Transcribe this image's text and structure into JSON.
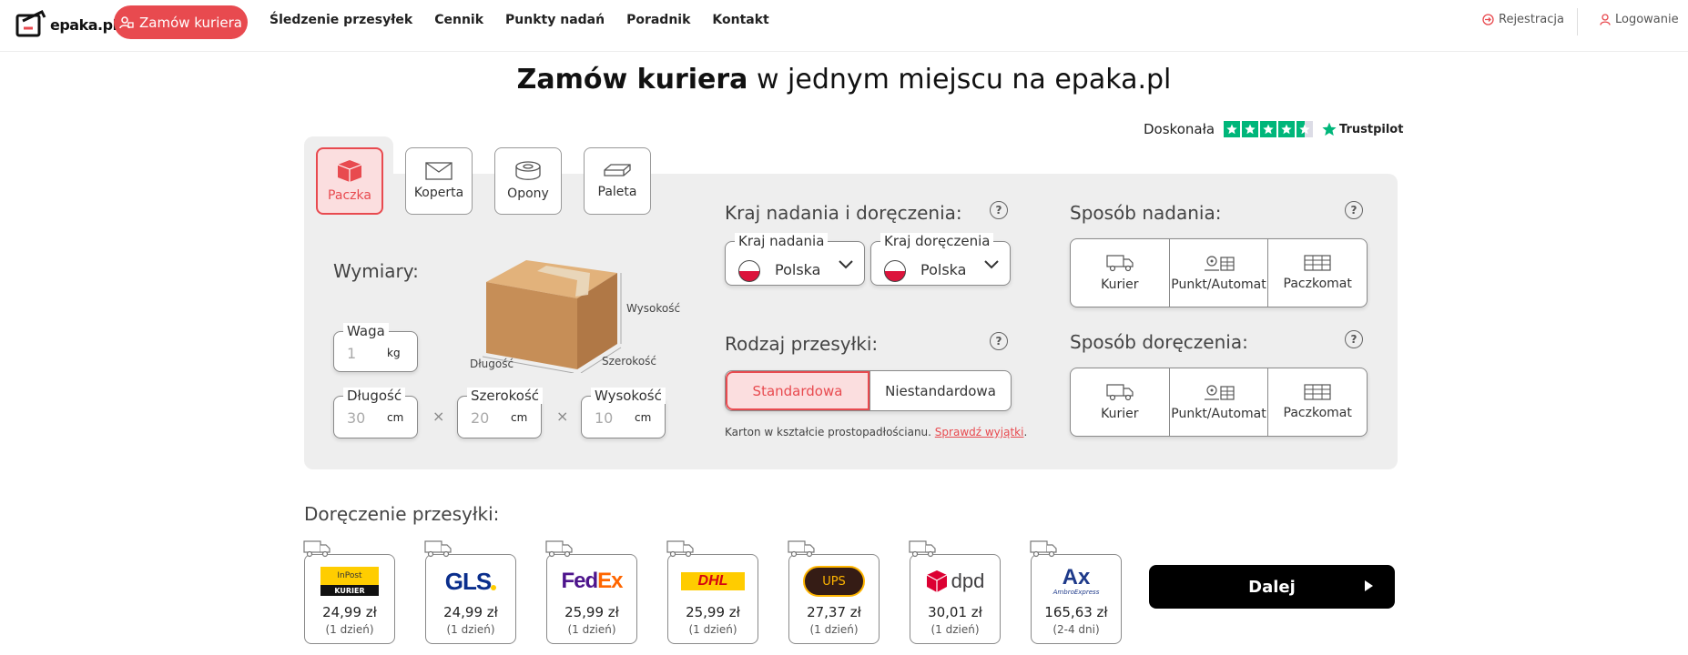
{
  "brand": {
    "name": "epaka.pl",
    "accent": "#e84a4f"
  },
  "header": {
    "order_button": "Zamów kuriera",
    "nav": [
      "Śledzenie przesyłek",
      "Cennik",
      "Punkty nadań",
      "Poradnik",
      "Kontakt"
    ],
    "register": "Rejestracja",
    "login": "Logowanie"
  },
  "headline": {
    "bold": "Zamów kuriera",
    "rest": " w jednym miejscu na epaka.pl"
  },
  "trustpilot": {
    "rating_text": "Doskonała",
    "brand": "Trustpilot",
    "stars": 4.5,
    "star_color": "#00b67a"
  },
  "parcel_types": [
    {
      "label": "Paczka",
      "icon": "box-icon",
      "active": true
    },
    {
      "label": "Koperta",
      "icon": "envelope-icon",
      "active": false
    },
    {
      "label": "Opony",
      "icon": "tire-icon",
      "active": false
    },
    {
      "label": "Paleta",
      "icon": "pallet-icon",
      "active": false
    }
  ],
  "dimensions": {
    "title": "Wymiary:",
    "box_labels": {
      "height": "Wysokość",
      "width": "Szerokość",
      "length": "Długość"
    },
    "weight": {
      "label": "Waga",
      "placeholder": "1",
      "unit": "kg"
    },
    "length": {
      "label": "Długość",
      "placeholder": "30",
      "unit": "cm"
    },
    "width": {
      "label": "Szerokość",
      "placeholder": "20",
      "unit": "cm"
    },
    "height": {
      "label": "Wysokość",
      "placeholder": "10",
      "unit": "cm"
    },
    "times": "×"
  },
  "countries": {
    "title": "Kraj nadania i doręczenia:",
    "help": "?",
    "origin": {
      "label": "Kraj nadania",
      "value": "Polska"
    },
    "destination": {
      "label": "Kraj doręczenia",
      "value": "Polska"
    }
  },
  "shipment_type": {
    "title": "Rodzaj przesyłki:",
    "help": "?",
    "options": [
      "Standardowa",
      "Niestandardowa"
    ],
    "selected": "Standardowa",
    "note": "Karton w kształcie prostopadłościanu.",
    "note_link": "Sprawdź wyjątki"
  },
  "send_method": {
    "title": "Sposób nadania:",
    "help": "?",
    "options": [
      "Kurier",
      "Punkt/Automat",
      "Paczkomat"
    ]
  },
  "delivery_method": {
    "title": "Sposób doręczenia:",
    "help": "?",
    "options": [
      "Kurier",
      "Punkt/Automat",
      "Paczkomat"
    ]
  },
  "delivery": {
    "title": "Doręczenie przesyłki:",
    "carriers": [
      {
        "name": "InPost Kurier",
        "logo_top": "InPost",
        "logo_bottom": "KURIER",
        "price": "24,99 zł",
        "time": "(1 dzień)",
        "color": "#ffcd00"
      },
      {
        "name": "GLS",
        "logo": "GLS",
        "price": "24,99 zł",
        "time": "(1 dzień)",
        "color": "#0a2e8c"
      },
      {
        "name": "FedEx",
        "logo_a": "Fed",
        "logo_b": "Ex",
        "price": "25,99 zł",
        "time": "(1 dzień)",
        "color": "#4d148c"
      },
      {
        "name": "DHL",
        "logo": "DHL",
        "price": "25,99 zł",
        "time": "(1 dzień)",
        "color": "#d40511"
      },
      {
        "name": "UPS",
        "logo": "UPS",
        "price": "27,37 zł",
        "time": "(1 dzień)",
        "color": "#351c15"
      },
      {
        "name": "dpd",
        "logo": "dpd",
        "price": "30,01 zł",
        "time": "(1 dzień)",
        "color": "#dc0032"
      },
      {
        "name": "Ambro Express",
        "logo_a": "Ax",
        "logo_b": "AmbroExpress",
        "price": "165,63 zł",
        "time": "(2-4 dni)",
        "color": "#1e3a8a"
      }
    ],
    "next_button": "Dalej"
  }
}
